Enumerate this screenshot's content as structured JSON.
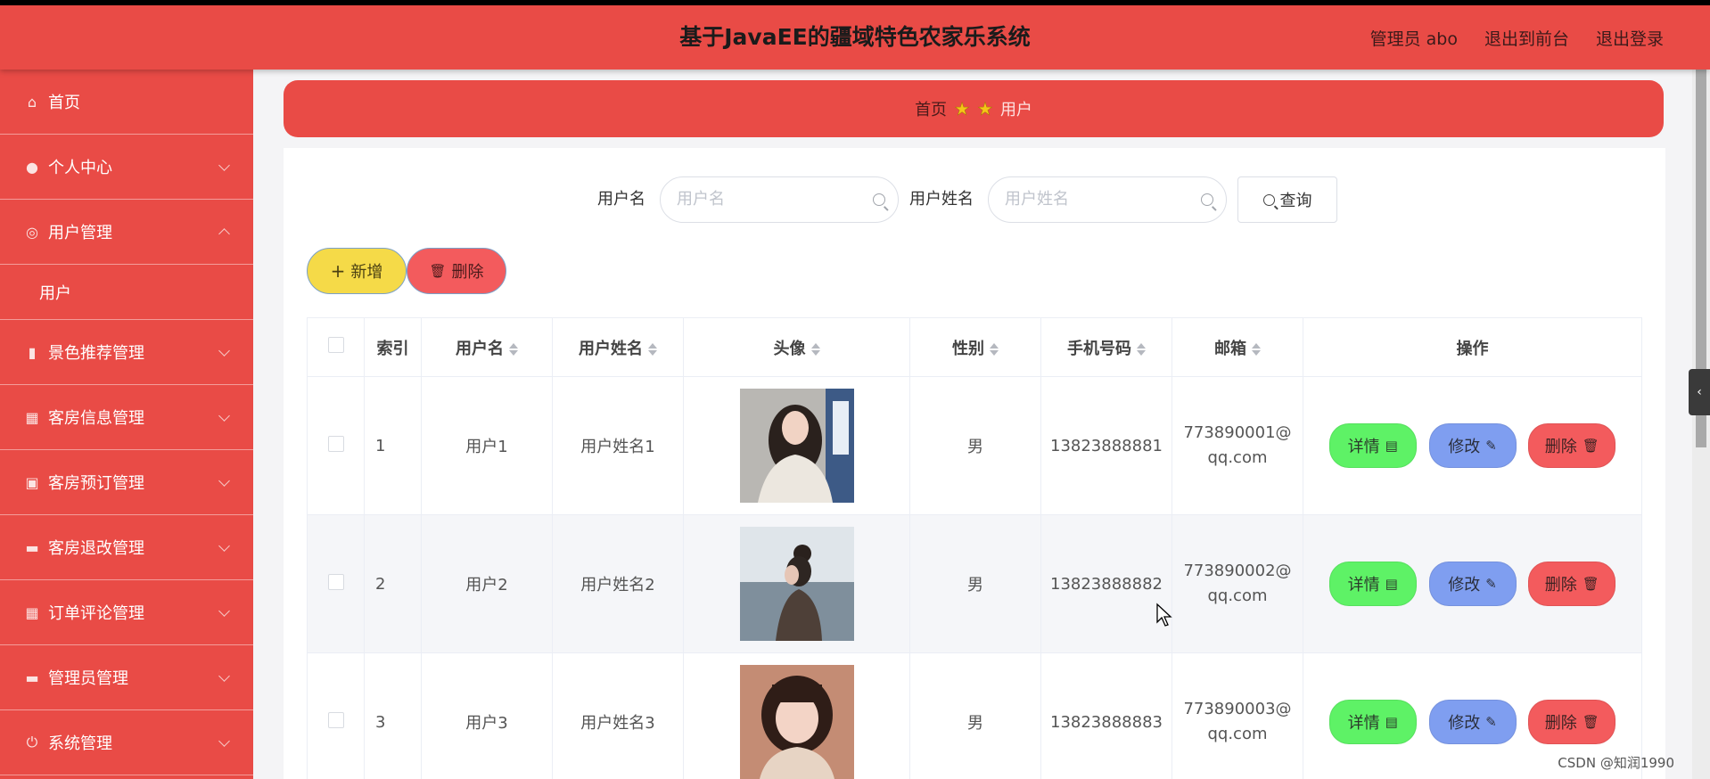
{
  "header": {
    "title": "基于JavaEE的疆域特色农家乐系统",
    "admin_label": "管理员 abo",
    "back_front": "退出到前台",
    "logout": "退出登录"
  },
  "sidebar": {
    "items": [
      {
        "label": "首页",
        "icon": "home-icon",
        "glyph": "⌂"
      },
      {
        "label": "个人中心",
        "icon": "user-icon",
        "glyph": "●"
      },
      {
        "label": "用户管理",
        "icon": "settings-icon",
        "glyph": "◎"
      },
      {
        "label": "景色推荐管理",
        "icon": "bar-chart-icon",
        "glyph": "▮"
      },
      {
        "label": "客房信息管理",
        "icon": "grid-icon",
        "glyph": "▦"
      },
      {
        "label": "客房预订管理",
        "icon": "clipboard-icon",
        "glyph": "▣"
      },
      {
        "label": "客房退改管理",
        "icon": "briefcase-icon",
        "glyph": "▬"
      },
      {
        "label": "订单评论管理",
        "icon": "apps-icon",
        "glyph": "▦"
      },
      {
        "label": "管理员管理",
        "icon": "message-icon",
        "glyph": "▬"
      },
      {
        "label": "系统管理",
        "icon": "power-icon",
        "glyph": "⏻"
      }
    ],
    "sub_user": "用户"
  },
  "breadcrumb": {
    "home": "首页",
    "current": "用户"
  },
  "search": {
    "username_label": "用户名",
    "username_placeholder": "用户名",
    "realname_label": "用户姓名",
    "realname_placeholder": "用户姓名",
    "query_label": "查询"
  },
  "actions": {
    "add_label": "新增",
    "delete_label": "删除"
  },
  "table": {
    "headers": {
      "index": "索引",
      "username": "用户名",
      "realname": "用户姓名",
      "avatar": "头像",
      "gender": "性别",
      "phone": "手机号码",
      "email": "邮箱",
      "ops": "操作"
    },
    "rows": [
      {
        "index": "1",
        "username": "用户1",
        "realname": "用户姓名1",
        "gender": "男",
        "phone": "13823888881",
        "email_1": "773890001@",
        "email_2": "qq.com"
      },
      {
        "index": "2",
        "username": "用户2",
        "realname": "用户姓名2",
        "gender": "男",
        "phone": "13823888882",
        "email_1": "773890002@",
        "email_2": "qq.com"
      },
      {
        "index": "3",
        "username": "用户3",
        "realname": "用户姓名3",
        "gender": "男",
        "phone": "13823888883",
        "email_1": "773890003@",
        "email_2": "qq.com"
      }
    ],
    "op_detail": "详情",
    "op_edit": "修改",
    "op_delete": "删除"
  },
  "watermark": "CSDN @知润1990",
  "colors": {
    "primary": "#e94b46",
    "add": "#f5da48",
    "delete": "#f35b5d",
    "detail": "#5ef266",
    "edit": "#7f9ef0"
  }
}
